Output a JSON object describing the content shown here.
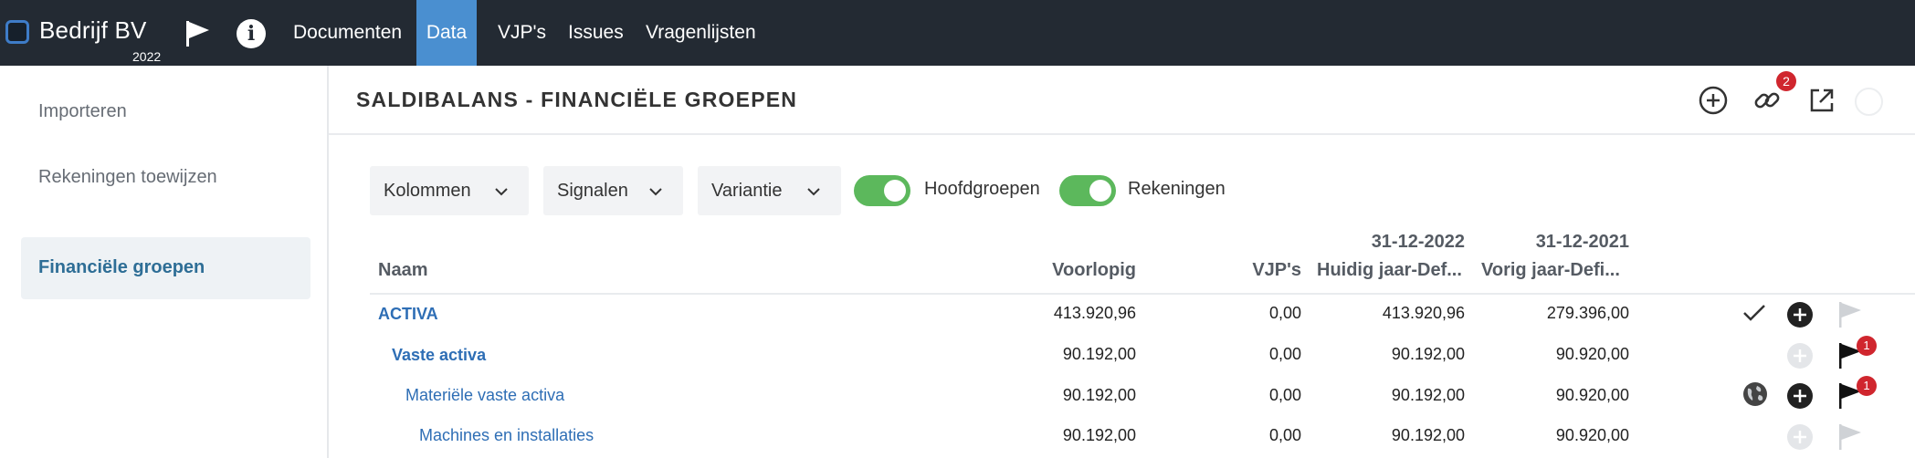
{
  "app": {
    "name": "Bedrijf BV",
    "year": "2022"
  },
  "nav": {
    "items": [
      {
        "label": "Documenten",
        "active": false
      },
      {
        "label": "Data",
        "active": true
      },
      {
        "label": "VJP's",
        "active": false
      },
      {
        "label": "Issues",
        "active": false
      },
      {
        "label": "Vragenlijsten",
        "active": false
      }
    ]
  },
  "sidebar": {
    "items": [
      {
        "label": "Importeren"
      },
      {
        "label": "Rekeningen toewijzen"
      },
      {
        "label": "Financiële groepen",
        "active": true
      }
    ]
  },
  "header": {
    "title": "SALDIBALANS - FINANCIËLE GROEPEN",
    "link_count": "2",
    "icons": [
      "add-circle-icon",
      "link-icon",
      "external-link-icon",
      "status-circle-icon"
    ]
  },
  "filters": {
    "dropdowns": [
      {
        "label": "Kolommen"
      },
      {
        "label": "Signalen"
      },
      {
        "label": "Variantie"
      }
    ],
    "toggles": [
      {
        "label": "Hoofdgroepen",
        "on": true
      },
      {
        "label": "Rekeningen",
        "on": true
      }
    ]
  },
  "table": {
    "columns": {
      "name": "Naam",
      "voorlopig": "Voorlopig",
      "vjps": "VJP's",
      "current_date": "31-12-2022",
      "current": "Huidig jaar-Def...",
      "prior_date": "31-12-2021",
      "prior": "Vorig jaar-Defi..."
    },
    "rows": [
      {
        "name": "ACTIVA",
        "level": 1,
        "voorlopig": "413.920,96",
        "vjps": "0,00",
        "current": "413.920,96",
        "prior": "279.396,00",
        "status_icon": "checkmark-icon",
        "add_active": true,
        "flag_active": false,
        "flag_count": ""
      },
      {
        "name": "Vaste activa",
        "level": 2,
        "voorlopig": "90.192,00",
        "vjps": "0,00",
        "current": "90.192,00",
        "prior": "90.920,00",
        "status_icon": "",
        "add_active": false,
        "flag_active": true,
        "flag_count": "1"
      },
      {
        "name": "Materiële vaste activa",
        "level": 3,
        "voorlopig": "90.192,00",
        "vjps": "0,00",
        "current": "90.192,00",
        "prior": "90.920,00",
        "status_icon": "globe-icon",
        "add_active": true,
        "flag_active": true,
        "flag_count": "1"
      },
      {
        "name": "Machines en installaties",
        "level": 4,
        "voorlopig": "90.192,00",
        "vjps": "0,00",
        "current": "90.192,00",
        "prior": "90.920,00",
        "status_icon": "",
        "add_active": false,
        "flag_active": false,
        "flag_count": ""
      }
    ]
  },
  "colors": {
    "topbar": "#232a33",
    "nav_active": "#4a8fd0",
    "link_blue": "#2e6eb5",
    "toggle_green": "#5cb85c",
    "badge_red": "#d0262e"
  }
}
